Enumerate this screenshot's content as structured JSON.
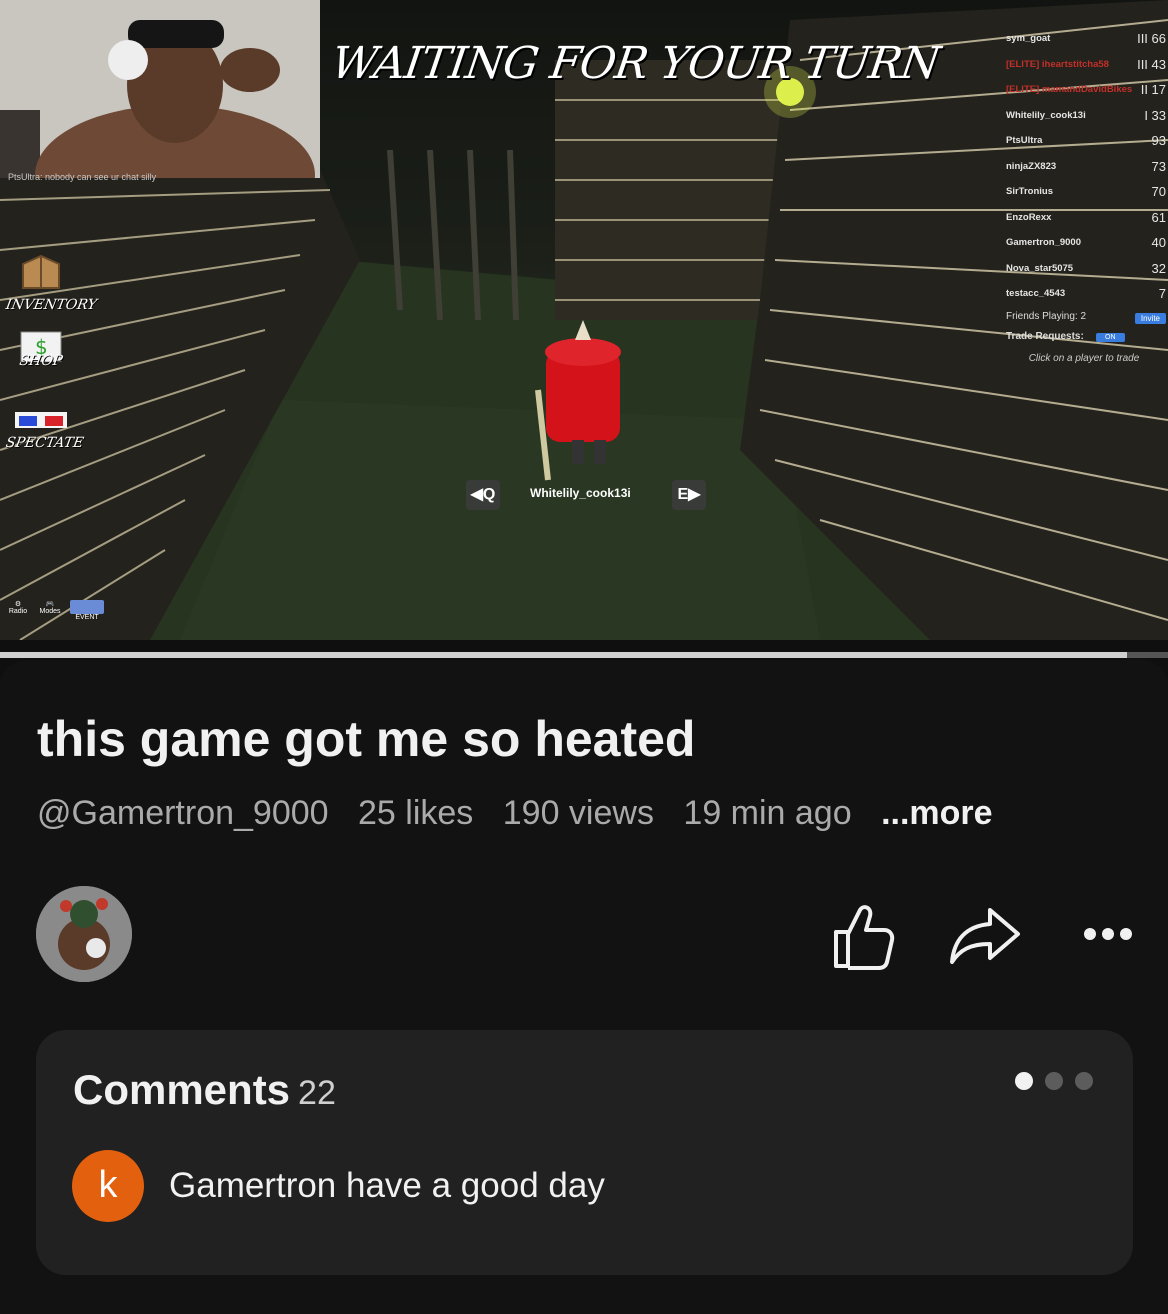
{
  "video": {
    "game_title": "WAITING FOR YOUR TURN",
    "chat_line": "PtsUltra: nobody can see ur chat silly",
    "side_buttons": [
      {
        "label": "INVENTORY",
        "icon": "inventory-box-icon"
      },
      {
        "label": "SHOP",
        "icon": "shop-bag-icon"
      },
      {
        "label": "SPECTATE",
        "icon": "3d-glasses-icon"
      }
    ],
    "bottom_icons": [
      {
        "label": "Radio",
        "icon": "radio-icon"
      },
      {
        "label": "Modes",
        "icon": "gamepad-icon"
      },
      {
        "label": "EVENT",
        "icon": "event-icon"
      }
    ],
    "leaderboard": [
      {
        "name": "sym_goat",
        "value": "III 66",
        "red": false
      },
      {
        "name": "[ELITE] iheartstitcha58",
        "value": "III 43",
        "red": true
      },
      {
        "name": "[ELITE] mamandDavidBikes",
        "value": "II 17",
        "red": true
      },
      {
        "name": "Whitelily_cook13i",
        "value": "I 33",
        "red": false
      },
      {
        "name": "PtsUltra",
        "value": "93",
        "red": false
      },
      {
        "name": "ninjaZX823",
        "value": "73",
        "red": false
      },
      {
        "name": "SirTronius",
        "value": "70",
        "red": false
      },
      {
        "name": "EnzoRexx",
        "value": "61",
        "red": false
      },
      {
        "name": "Gamertron_9000",
        "value": "40",
        "red": false
      },
      {
        "name": "Nova_star5075",
        "value": "32",
        "red": false
      },
      {
        "name": "testacc_4543",
        "value": "7",
        "red": false
      }
    ],
    "friends_playing": "Friends Playing: 2",
    "invite_label": "Invite",
    "trade_requests": "Trade Requests:",
    "trade_toggle": "ON",
    "trade_hint": "Click on a player to trade",
    "turn_left_key": "Q",
    "turn_right_key": "E",
    "turn_player": "Whitelily_cook13i",
    "progress": 0.965
  },
  "post": {
    "title": "this game got me so heated",
    "channel": "@Gamertron_9000",
    "likes": "25 likes",
    "views": "190 views",
    "time": "19 min ago",
    "more": "...more"
  },
  "actions": [
    "like-icon",
    "share-icon",
    "more-icon"
  ],
  "comments": {
    "label": "Comments",
    "count": "22",
    "first": {
      "avatar_letter": "k",
      "avatar_color": "#e3600f",
      "text": "Gamertron have a good day"
    }
  }
}
